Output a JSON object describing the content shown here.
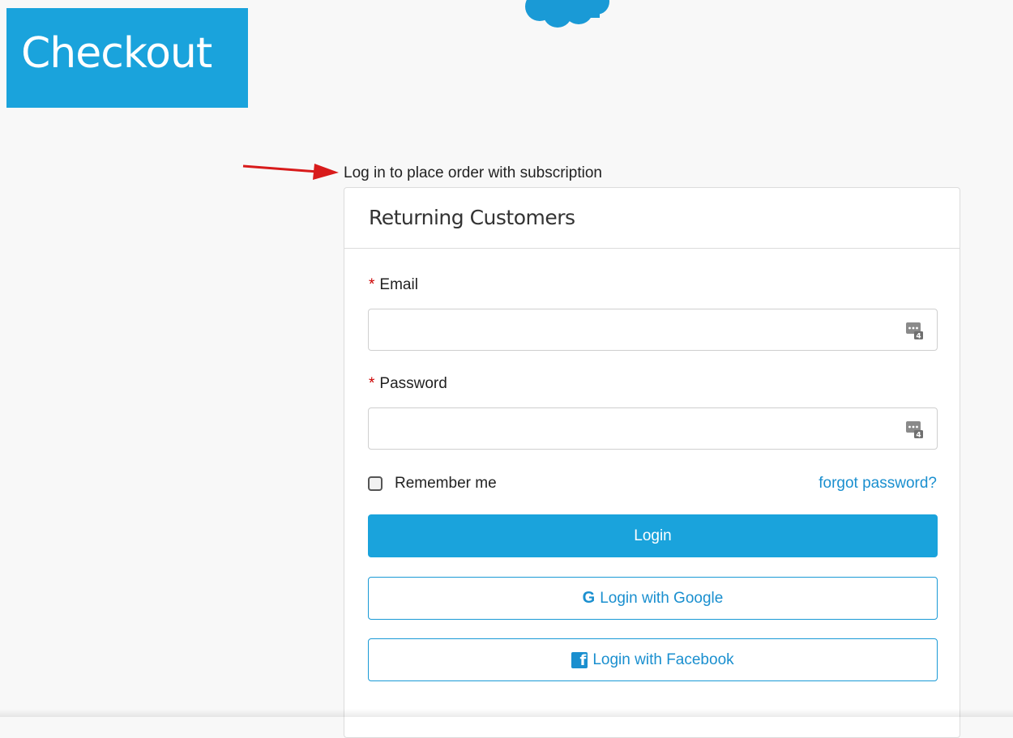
{
  "banner": {
    "title": "Checkout",
    "color": "#1aa3dc"
  },
  "logo": {
    "icon": "cloud-logo"
  },
  "note": {
    "text": "Log in to place order with subscription",
    "arrow_color": "#d81b1b"
  },
  "login_card": {
    "title": "Returning Customers",
    "email": {
      "required_mark": "*",
      "label": "Email",
      "value": "",
      "icon": "keychain-icon"
    },
    "password": {
      "required_mark": "*",
      "label": "Password",
      "value": "",
      "icon": "keychain-icon"
    },
    "remember_me": {
      "label": "Remember me",
      "checked": false
    },
    "forgot_password": "forgot password?",
    "login_button": "Login",
    "google_button": {
      "icon_text": "G",
      "label": "Login with Google"
    },
    "facebook_button": {
      "icon_text": "f",
      "label": "Login with Facebook"
    }
  },
  "colors": {
    "accent": "#1aa3dc",
    "link": "#1a8fcf",
    "required": "#cc0000"
  }
}
